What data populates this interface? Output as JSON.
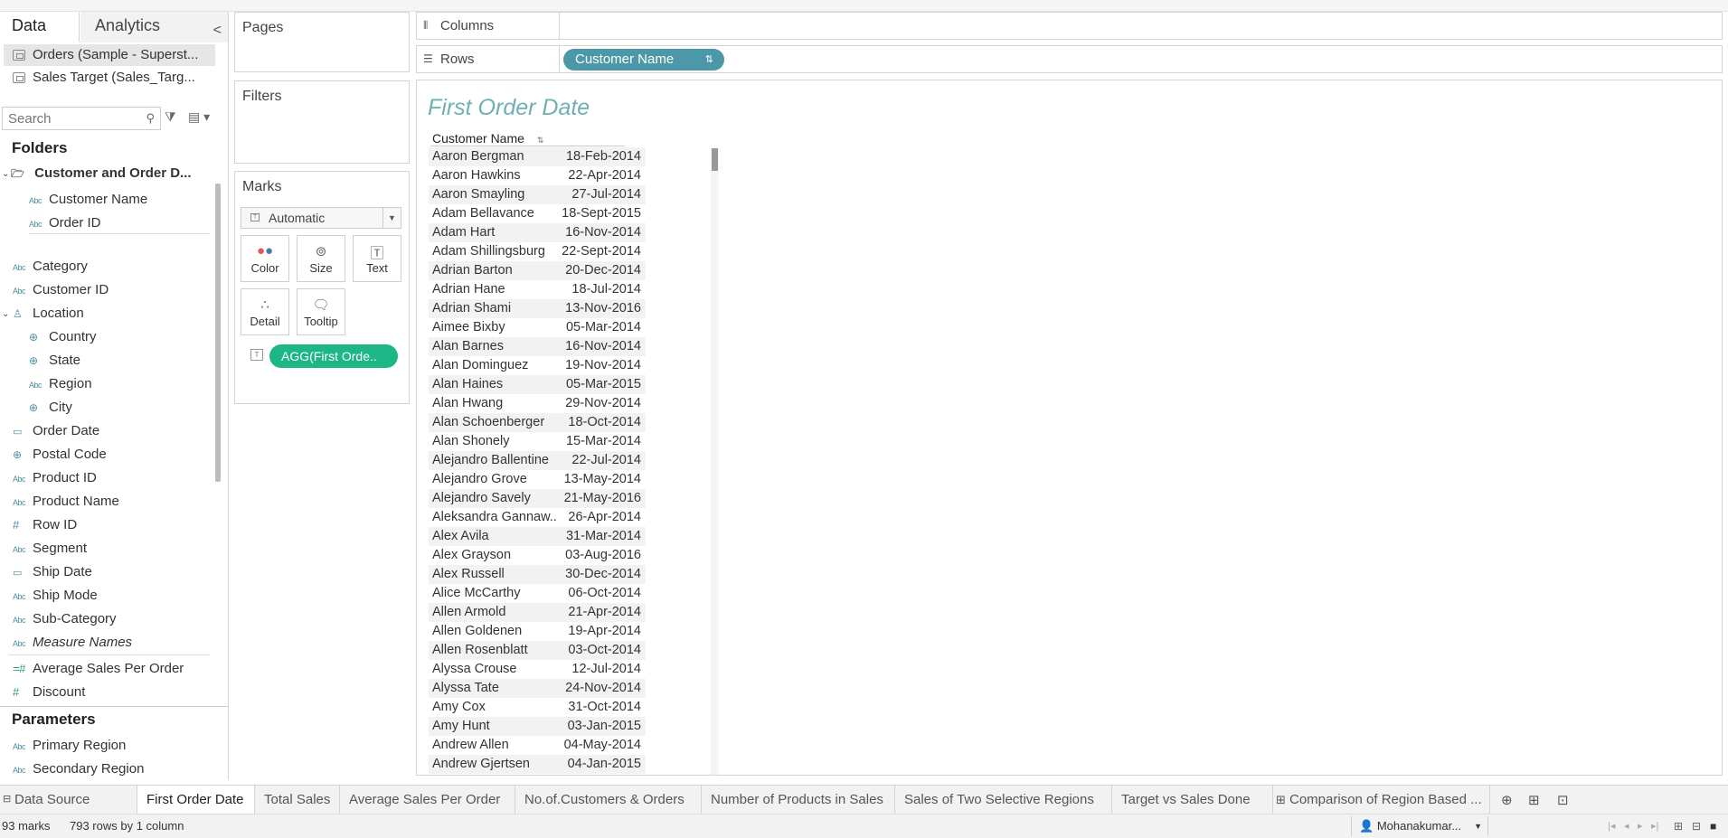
{
  "data_pane": {
    "tab_data": "Data",
    "tab_analytics": "Analytics",
    "collapse_glyph": "<",
    "sources": [
      "Orders (Sample - Superst...",
      "Sales Target (Sales_Targ..."
    ],
    "search_placeholder": "Search",
    "folders_heading": "Folders",
    "folder_name": "Customer and Order D...",
    "folder_fields": [
      {
        "icon": "Abc",
        "label": "Customer Name"
      },
      {
        "icon": "Abc",
        "label": "Order ID"
      }
    ],
    "fields": [
      {
        "icon": "Abc",
        "label": "Category"
      },
      {
        "icon": "Abc",
        "label": "Customer ID"
      },
      {
        "icon": "hierarchy",
        "label": "Location"
      },
      {
        "icon": "globe",
        "label": "Country"
      },
      {
        "icon": "globe",
        "label": "State"
      },
      {
        "icon": "Abc",
        "label": "Region"
      },
      {
        "icon": "globe",
        "label": "City"
      },
      {
        "icon": "calendar",
        "label": "Order Date"
      },
      {
        "icon": "globe",
        "label": "Postal Code"
      },
      {
        "icon": "Abc",
        "label": "Product ID"
      },
      {
        "icon": "Abc",
        "label": "Product Name"
      },
      {
        "icon": "#",
        "label": "Row ID"
      },
      {
        "icon": "Abc",
        "label": "Segment"
      },
      {
        "icon": "calendar",
        "label": "Ship Date"
      },
      {
        "icon": "Abc",
        "label": "Ship Mode"
      },
      {
        "icon": "Abc",
        "label": "Sub-Category"
      },
      {
        "icon": "Abc",
        "label": "Measure Names"
      }
    ],
    "measures": [
      {
        "icon": "=#",
        "label": "Average Sales Per Order"
      },
      {
        "icon": "#",
        "label": "Discount"
      }
    ],
    "parameters_heading": "Parameters",
    "parameters": [
      {
        "icon": "Abc",
        "label": "Primary Region"
      },
      {
        "icon": "Abc",
        "label": "Secondary Region"
      }
    ]
  },
  "cards": {
    "pages": "Pages",
    "filters": "Filters",
    "marks": "Marks",
    "mark_type": "Automatic",
    "mark_buttons": [
      "Color",
      "Size",
      "Text",
      "Detail",
      "Tooltip"
    ],
    "agg_pill": "AGG(First Orde.."
  },
  "shelves": {
    "columns": "Columns",
    "rows": "Rows",
    "rows_pill": "Customer Name"
  },
  "view": {
    "title": "First Order Date",
    "column_header": "Customer Name",
    "rows": [
      [
        "Aaron Bergman",
        "18-Feb-2014"
      ],
      [
        "Aaron Hawkins",
        "22-Apr-2014"
      ],
      [
        "Aaron Smayling",
        "27-Jul-2014"
      ],
      [
        "Adam Bellavance",
        "18-Sept-2015"
      ],
      [
        "Adam Hart",
        "16-Nov-2014"
      ],
      [
        "Adam Shillingsburg",
        "22-Sept-2014"
      ],
      [
        "Adrian Barton",
        "20-Dec-2014"
      ],
      [
        "Adrian Hane",
        "18-Jul-2014"
      ],
      [
        "Adrian Shami",
        "13-Nov-2016"
      ],
      [
        "Aimee Bixby",
        "05-Mar-2014"
      ],
      [
        "Alan Barnes",
        "16-Nov-2014"
      ],
      [
        "Alan Dominguez",
        "19-Nov-2014"
      ],
      [
        "Alan Haines",
        "05-Mar-2015"
      ],
      [
        "Alan Hwang",
        "29-Nov-2014"
      ],
      [
        "Alan Schoenberger",
        "18-Oct-2014"
      ],
      [
        "Alan Shonely",
        "15-Mar-2014"
      ],
      [
        "Alejandro Ballentine",
        "22-Jul-2014"
      ],
      [
        "Alejandro Grove",
        "13-May-2014"
      ],
      [
        "Alejandro Savely",
        "21-May-2016"
      ],
      [
        "Aleksandra Gannaw..",
        "26-Apr-2014"
      ],
      [
        "Alex Avila",
        "31-Mar-2014"
      ],
      [
        "Alex Grayson",
        "03-Aug-2016"
      ],
      [
        "Alex Russell",
        "30-Dec-2014"
      ],
      [
        "Alice McCarthy",
        "06-Oct-2014"
      ],
      [
        "Allen Armold",
        "21-Apr-2014"
      ],
      [
        "Allen Goldenen",
        "19-Apr-2014"
      ],
      [
        "Allen Rosenblatt",
        "03-Oct-2014"
      ],
      [
        "Alyssa Crouse",
        "12-Jul-2014"
      ],
      [
        "Alyssa Tate",
        "24-Nov-2014"
      ],
      [
        "Amy Cox",
        "31-Oct-2014"
      ],
      [
        "Amy Hunt",
        "03-Jan-2015"
      ],
      [
        "Andrew Allen",
        "04-May-2014"
      ],
      [
        "Andrew Gjertsen",
        "04-Jan-2015"
      ]
    ]
  },
  "sheet_tabs": {
    "data_source": "Data Source",
    "sheets": [
      "First Order Date",
      "Total Sales",
      "Average Sales Per Order",
      "No.of.Customers & Orders",
      "Number of Products in Sales",
      "Sales of Two Selective Regions",
      "Target vs Sales Done",
      "Comparison of Region Based ..."
    ]
  },
  "status": {
    "marks": "93 marks",
    "rows_cols": "793 rows by 1 column",
    "user": "Mohanakumar..."
  },
  "colors": {
    "dimension_pill": "#4c97a8",
    "measure_pill": "#1db686",
    "title": "#6fb0b5"
  }
}
